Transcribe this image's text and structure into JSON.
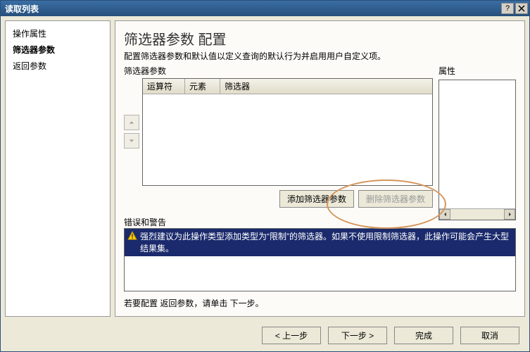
{
  "titlebar": {
    "title": "读取列表"
  },
  "nav": {
    "items": [
      {
        "label": "操作属性",
        "active": false
      },
      {
        "label": "筛选器参数",
        "active": true
      },
      {
        "label": "返回参数",
        "active": false
      }
    ]
  },
  "main": {
    "title": "筛选器参数 配置",
    "desc": "配置筛选器参数和默认值以定义查询的默认行为并启用用户自定义项。",
    "filter_label": "筛选器参数",
    "prop_label": "属性",
    "grid_headers": {
      "h1": "运算符",
      "h2": "元素",
      "h3": "筛选器"
    },
    "add_btn": "添加筛选器参数",
    "del_btn": "删除筛选器参数",
    "err_label": "错误和警告",
    "warning_text": "强烈建议为此操作类型添加类型为“限制”的筛选器。如果不使用限制筛选器，此操作可能会产生大型结果集。",
    "hint": "若要配置 返回参数，请单击 下一步。"
  },
  "footer": {
    "prev": "< 上一步",
    "next": "下一步 >",
    "finish": "完成",
    "cancel": "取消"
  }
}
